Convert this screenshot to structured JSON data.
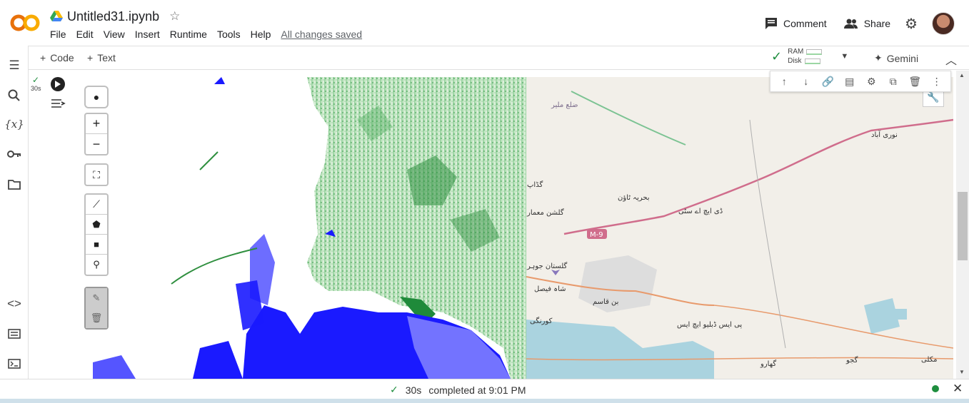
{
  "app": {
    "logo_text": "CO",
    "title": "Untitled31.ipynb"
  },
  "menu": {
    "items": [
      "File",
      "Edit",
      "View",
      "Insert",
      "Runtime",
      "Tools",
      "Help"
    ],
    "saved_status": "All changes saved"
  },
  "header_actions": {
    "comment_label": "Comment",
    "share_label": "Share"
  },
  "toolbar": {
    "add_code_label": "Code",
    "add_text_label": "Text",
    "ram_label": "RAM",
    "disk_label": "Disk",
    "gemini_label": "Gemini"
  },
  "cell": {
    "exec_time_badge": "30s"
  },
  "map_labels": {
    "malir": "ضلع ملیر",
    "noori_abad": "نوری آباد",
    "gadap": "گڈاپ",
    "gulshan_maymar": "گلشن معمار",
    "bahria_town": "بحریہ ٹاؤن",
    "dha_city": "ڈی ایچ اے سٹی",
    "m9": "M-9",
    "gulistan_jauhar": "گلستان جوہر",
    "shah_faisal": "شاہ فیصل",
    "bin_qasim": "بن قاسم",
    "korangi": "کورنگی",
    "pipri": "پی ایس ڈبلیو ایچ ایس",
    "gharo": "گھارو",
    "gujo": "گجو",
    "makli": "مکلی"
  },
  "status_bar": {
    "duration": "30s",
    "completed_text": "completed at 9:01 PM"
  },
  "colors": {
    "accent_orange": "#f9ab00",
    "accent_orange_dark": "#e8710a",
    "check_green": "#1e8e3e",
    "water_blue": "#1a1aff",
    "veg_green": "#1f8a3a"
  }
}
